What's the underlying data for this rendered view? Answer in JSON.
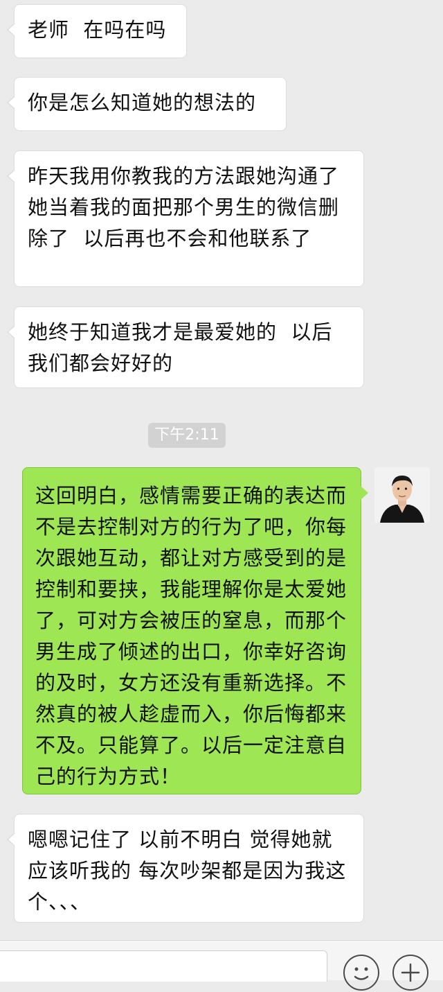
{
  "messages": [
    {
      "side": "left",
      "text": "老师  在吗在吗"
    },
    {
      "side": "left",
      "text": "你是怎么知道她的想法的"
    },
    {
      "side": "left",
      "text": "昨天我用你教我的方法跟她沟通了  她当着我的面把那个男生的微信删除了  以后再也不会和他联系了"
    },
    {
      "side": "left",
      "text": "她终于知道我才是最爱她的  以后我们都会好好的"
    },
    {
      "side": "right",
      "text": "这回明白，感情需要正确的表达而不是去控制对方的行为了吧，你每次跟她互动，都让对方感受到的是控制和要挟，我能理解你是太爱她了，可对方会被压的窒息，而那个男生成了倾述的出口，你幸好咨询的及时，女方还没有重新选择。不然真的被人趁虚而入，你后悔都来不及。只能算了。以后一定注意自己的行为方式！"
    },
    {
      "side": "left",
      "text": "嗯嗯记住了 以前不明白 觉得她就应该听我的 每次吵架都是因为我这个、、、"
    }
  ],
  "timestamp": "下午2:11",
  "colors": {
    "background": "#ebebeb",
    "incoming_bubble": "#ffffff",
    "outgoing_bubble": "#9ee653",
    "timestamp_bg": "#d2d2d2"
  },
  "icons": {
    "emoji": "emoji-icon",
    "plus": "plus-icon"
  }
}
